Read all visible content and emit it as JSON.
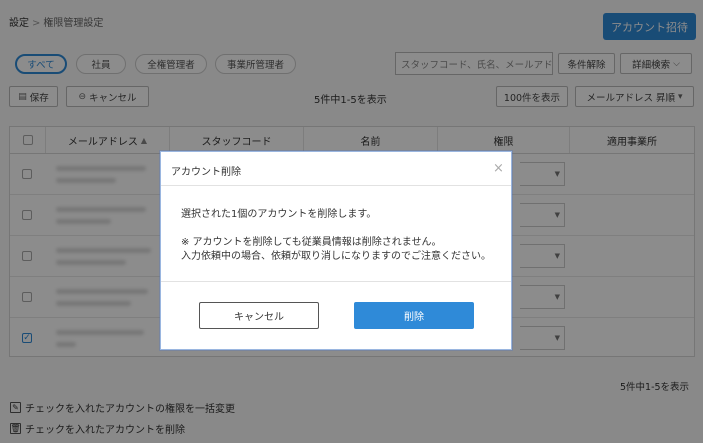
{
  "breadcrumb": {
    "parent": "設定",
    "separator": ">",
    "current": "権限管理設定"
  },
  "header": {
    "invite_button": "アカウント招待"
  },
  "filters": {
    "pills": [
      "すべて",
      "社員",
      "全権管理者",
      "事業所管理者"
    ],
    "active_index": 0
  },
  "search": {
    "placeholder": "スタッフコード、氏名、メールアドレス",
    "clear_label": "条件解除",
    "advanced_label": "詳細検索"
  },
  "toolbar": {
    "save_label": "保存",
    "cancel_label": "キャンセル",
    "count_text": "5件中1-5を表示",
    "per_page_label": "100件を表示",
    "sort_label": "メールアドレス 昇順"
  },
  "table": {
    "headers": [
      "メールアドレス",
      "スタッフコード",
      "名前",
      "権限",
      "適用事業所"
    ],
    "rows": [
      {
        "checked": false
      },
      {
        "checked": false
      },
      {
        "checked": false
      },
      {
        "checked": false
      },
      {
        "checked": true
      }
    ]
  },
  "footer": {
    "count_text": "5件中1-5を表示",
    "bulk_change_label": "チェックを入れたアカウントの権限を一括変更",
    "bulk_delete_label": "チェックを入れたアカウントを削除"
  },
  "modal": {
    "title": "アカウント削除",
    "close_glyph": "×",
    "message": "選択された1個のアカウントを削除します。",
    "note_line1": "※ アカウントを削除しても従業員情報は削除されません。",
    "note_line2": "入力依頼中の場合、依頼が取り消しになりますのでご注意ください。",
    "cancel_label": "キャンセル",
    "delete_label": "削除"
  },
  "colors": {
    "accent": "#2f8ad8",
    "overlay": "rgba(0,0,0,0.45)"
  }
}
